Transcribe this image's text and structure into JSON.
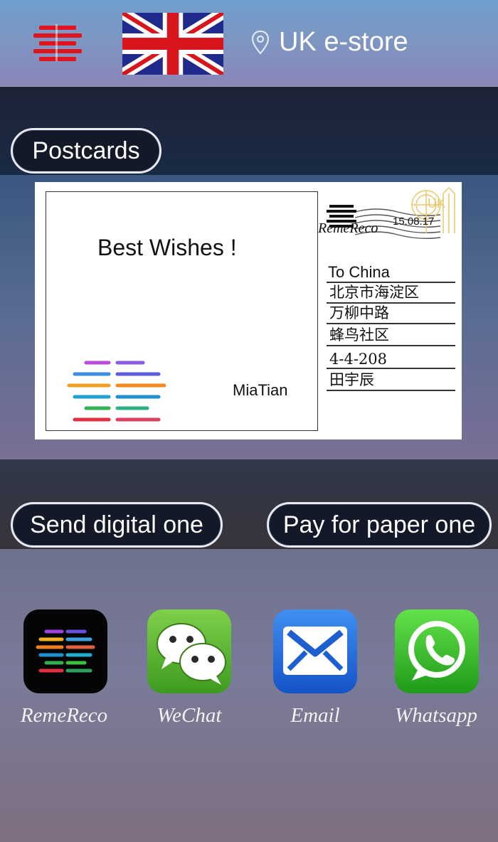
{
  "header": {
    "store_label": "UK e-store"
  },
  "section": {
    "postcards_label": "Postcards"
  },
  "postcard": {
    "greeting": "Best Wishes !",
    "signature": "MiaTian",
    "stamp_brand": "RemeReco",
    "stamp_date": "15.08.17",
    "address_lines": [
      "To China",
      "北京市海淀区",
      "万柳中路",
      "蜂鸟社区",
      "4-4-208",
      "田宇辰"
    ]
  },
  "actions": {
    "send_digital_label": "Send digital one",
    "pay_paper_label": "Pay for paper one"
  },
  "share_apps": [
    {
      "label": "RemeReco",
      "icon": "remereco-app-icon"
    },
    {
      "label": "WeChat",
      "icon": "wechat-app-icon"
    },
    {
      "label": "Email",
      "icon": "email-app-icon"
    },
    {
      "label": "Whatsapp",
      "icon": "whatsapp-app-icon"
    }
  ],
  "colors": {
    "brand_red": "#e0141c",
    "flag_blue": "#1f2a8c",
    "flag_red": "#d8141c"
  }
}
